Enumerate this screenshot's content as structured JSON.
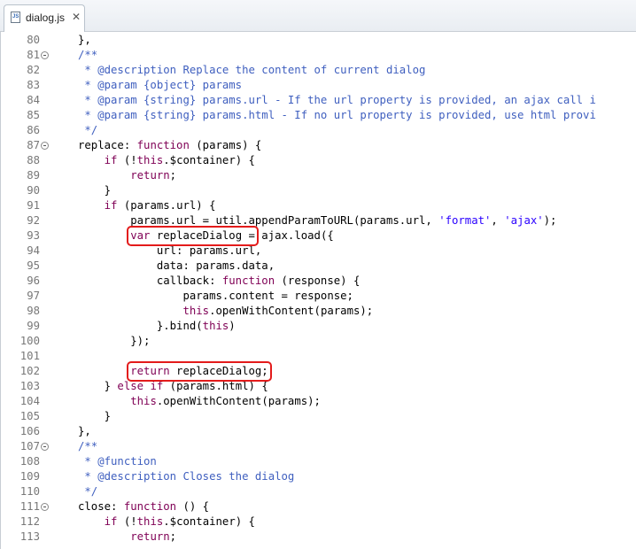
{
  "tab": {
    "label": "dialog.js",
    "icon": "js-file-icon",
    "close": "✕"
  },
  "lines": [
    {
      "n": "80",
      "fold": false,
      "tokens": [
        {
          "t": "},",
          "k": "n"
        }
      ]
    },
    {
      "n": "81",
      "fold": true,
      "tokens": [
        {
          "t": "/**",
          "k": "cm"
        }
      ]
    },
    {
      "n": "82",
      "fold": false,
      "tokens": [
        {
          "t": " * @description Replace the content of current dialog",
          "k": "cm"
        }
      ]
    },
    {
      "n": "83",
      "fold": false,
      "tokens": [
        {
          "t": " * @param {object} params",
          "k": "cm"
        }
      ]
    },
    {
      "n": "84",
      "fold": false,
      "tokens": [
        {
          "t": " * @param {string} params.url - If the url property is provided, an ajax call i",
          "k": "cm"
        }
      ]
    },
    {
      "n": "85",
      "fold": false,
      "tokens": [
        {
          "t": " * @param {string} params.html - If no url property is provided, use html provi",
          "k": "cm"
        }
      ]
    },
    {
      "n": "86",
      "fold": false,
      "tokens": [
        {
          "t": " */",
          "k": "cm"
        }
      ]
    },
    {
      "n": "87",
      "fold": true,
      "tokens": [
        {
          "t": "replace: ",
          "k": "n"
        },
        {
          "t": "function",
          "k": "kw"
        },
        {
          "t": " (params) {",
          "k": "n"
        }
      ]
    },
    {
      "n": "88",
      "fold": false,
      "tokens": [
        {
          "t": "    ",
          "k": "n"
        },
        {
          "t": "if",
          "k": "kw"
        },
        {
          "t": " (!",
          "k": "n"
        },
        {
          "t": "this",
          "k": "kw"
        },
        {
          "t": ".$container) {",
          "k": "n"
        }
      ]
    },
    {
      "n": "89",
      "fold": false,
      "tokens": [
        {
          "t": "        ",
          "k": "n"
        },
        {
          "t": "return",
          "k": "kw"
        },
        {
          "t": ";",
          "k": "n"
        }
      ]
    },
    {
      "n": "90",
      "fold": false,
      "tokens": [
        {
          "t": "    }",
          "k": "n"
        }
      ]
    },
    {
      "n": "91",
      "fold": false,
      "tokens": [
        {
          "t": "    ",
          "k": "n"
        },
        {
          "t": "if",
          "k": "kw"
        },
        {
          "t": " (params.url) {",
          "k": "n"
        }
      ]
    },
    {
      "n": "92",
      "fold": false,
      "tokens": [
        {
          "t": "        params.url = util.appendParamToURL(params.url, ",
          "k": "n"
        },
        {
          "t": "'format'",
          "k": "str"
        },
        {
          "t": ", ",
          "k": "n"
        },
        {
          "t": "'ajax'",
          "k": "str"
        },
        {
          "t": ");",
          "k": "n"
        }
      ]
    },
    {
      "n": "93",
      "fold": false,
      "tokens": [
        {
          "t": "        ",
          "k": "n"
        },
        {
          "t": "var",
          "k": "kw"
        },
        {
          "t": " replaceDialog = ajax.load({",
          "k": "n"
        }
      ]
    },
    {
      "n": "94",
      "fold": false,
      "tokens": [
        {
          "t": "            url: params.url,",
          "k": "n"
        }
      ]
    },
    {
      "n": "95",
      "fold": false,
      "tokens": [
        {
          "t": "            data: params.data,",
          "k": "n"
        }
      ]
    },
    {
      "n": "96",
      "fold": false,
      "tokens": [
        {
          "t": "            callback: ",
          "k": "n"
        },
        {
          "t": "function",
          "k": "kw"
        },
        {
          "t": " (response) {",
          "k": "n"
        }
      ]
    },
    {
      "n": "97",
      "fold": false,
      "tokens": [
        {
          "t": "                params.content = response;",
          "k": "n"
        }
      ]
    },
    {
      "n": "98",
      "fold": false,
      "tokens": [
        {
          "t": "                ",
          "k": "n"
        },
        {
          "t": "this",
          "k": "kw"
        },
        {
          "t": ".openWithContent(params);",
          "k": "n"
        }
      ]
    },
    {
      "n": "99",
      "fold": false,
      "tokens": [
        {
          "t": "            }.bind(",
          "k": "n"
        },
        {
          "t": "this",
          "k": "kw"
        },
        {
          "t": ")",
          "k": "n"
        }
      ]
    },
    {
      "n": "100",
      "fold": false,
      "tokens": [
        {
          "t": "        });",
          "k": "n"
        }
      ]
    },
    {
      "n": "101",
      "fold": false,
      "tokens": []
    },
    {
      "n": "102",
      "fold": false,
      "tokens": [
        {
          "t": "        ",
          "k": "n"
        },
        {
          "t": "return",
          "k": "kw"
        },
        {
          "t": " replaceDialog;",
          "k": "n"
        }
      ]
    },
    {
      "n": "103",
      "fold": false,
      "tokens": [
        {
          "t": "    } ",
          "k": "n"
        },
        {
          "t": "else",
          "k": "kw"
        },
        {
          "t": " ",
          "k": "n"
        },
        {
          "t": "if",
          "k": "kw"
        },
        {
          "t": " (params.html) {",
          "k": "n"
        }
      ]
    },
    {
      "n": "104",
      "fold": false,
      "tokens": [
        {
          "t": "        ",
          "k": "n"
        },
        {
          "t": "this",
          "k": "kw"
        },
        {
          "t": ".openWithContent(params);",
          "k": "n"
        }
      ]
    },
    {
      "n": "105",
      "fold": false,
      "tokens": [
        {
          "t": "    }",
          "k": "n"
        }
      ]
    },
    {
      "n": "106",
      "fold": false,
      "tokens": [
        {
          "t": "},",
          "k": "n"
        }
      ]
    },
    {
      "n": "107",
      "fold": true,
      "tokens": [
        {
          "t": "/**",
          "k": "cm"
        }
      ]
    },
    {
      "n": "108",
      "fold": false,
      "tokens": [
        {
          "t": " * @function",
          "k": "cm"
        }
      ]
    },
    {
      "n": "109",
      "fold": false,
      "tokens": [
        {
          "t": " * @description Closes the dialog",
          "k": "cm"
        }
      ]
    },
    {
      "n": "110",
      "fold": false,
      "tokens": [
        {
          "t": " */",
          "k": "cm"
        }
      ]
    },
    {
      "n": "111",
      "fold": true,
      "tokens": [
        {
          "t": "close: ",
          "k": "n"
        },
        {
          "t": "function",
          "k": "kw"
        },
        {
          "t": " () {",
          "k": "n"
        }
      ]
    },
    {
      "n": "112",
      "fold": false,
      "tokens": [
        {
          "t": "    ",
          "k": "n"
        },
        {
          "t": "if",
          "k": "kw"
        },
        {
          "t": " (!",
          "k": "n"
        },
        {
          "t": "this",
          "k": "kw"
        },
        {
          "t": ".$container) {",
          "k": "n"
        }
      ]
    },
    {
      "n": "113",
      "fold": false,
      "tokens": [
        {
          "t": "        ",
          "k": "n"
        },
        {
          "t": "return",
          "k": "kw"
        },
        {
          "t": ";",
          "k": "n"
        }
      ]
    }
  ],
  "highlights": [
    {
      "line": "93",
      "text": "var replaceDialog =",
      "color": "#e31b1b"
    },
    {
      "line": "102",
      "text": "return replaceDialog;",
      "color": "#e31b1b"
    }
  ],
  "colors": {
    "keyword": "#7f0055",
    "comment": "#3f5fbf",
    "string": "#2a00ff",
    "line_number": "#787878",
    "highlight_box": "#e31b1b"
  }
}
